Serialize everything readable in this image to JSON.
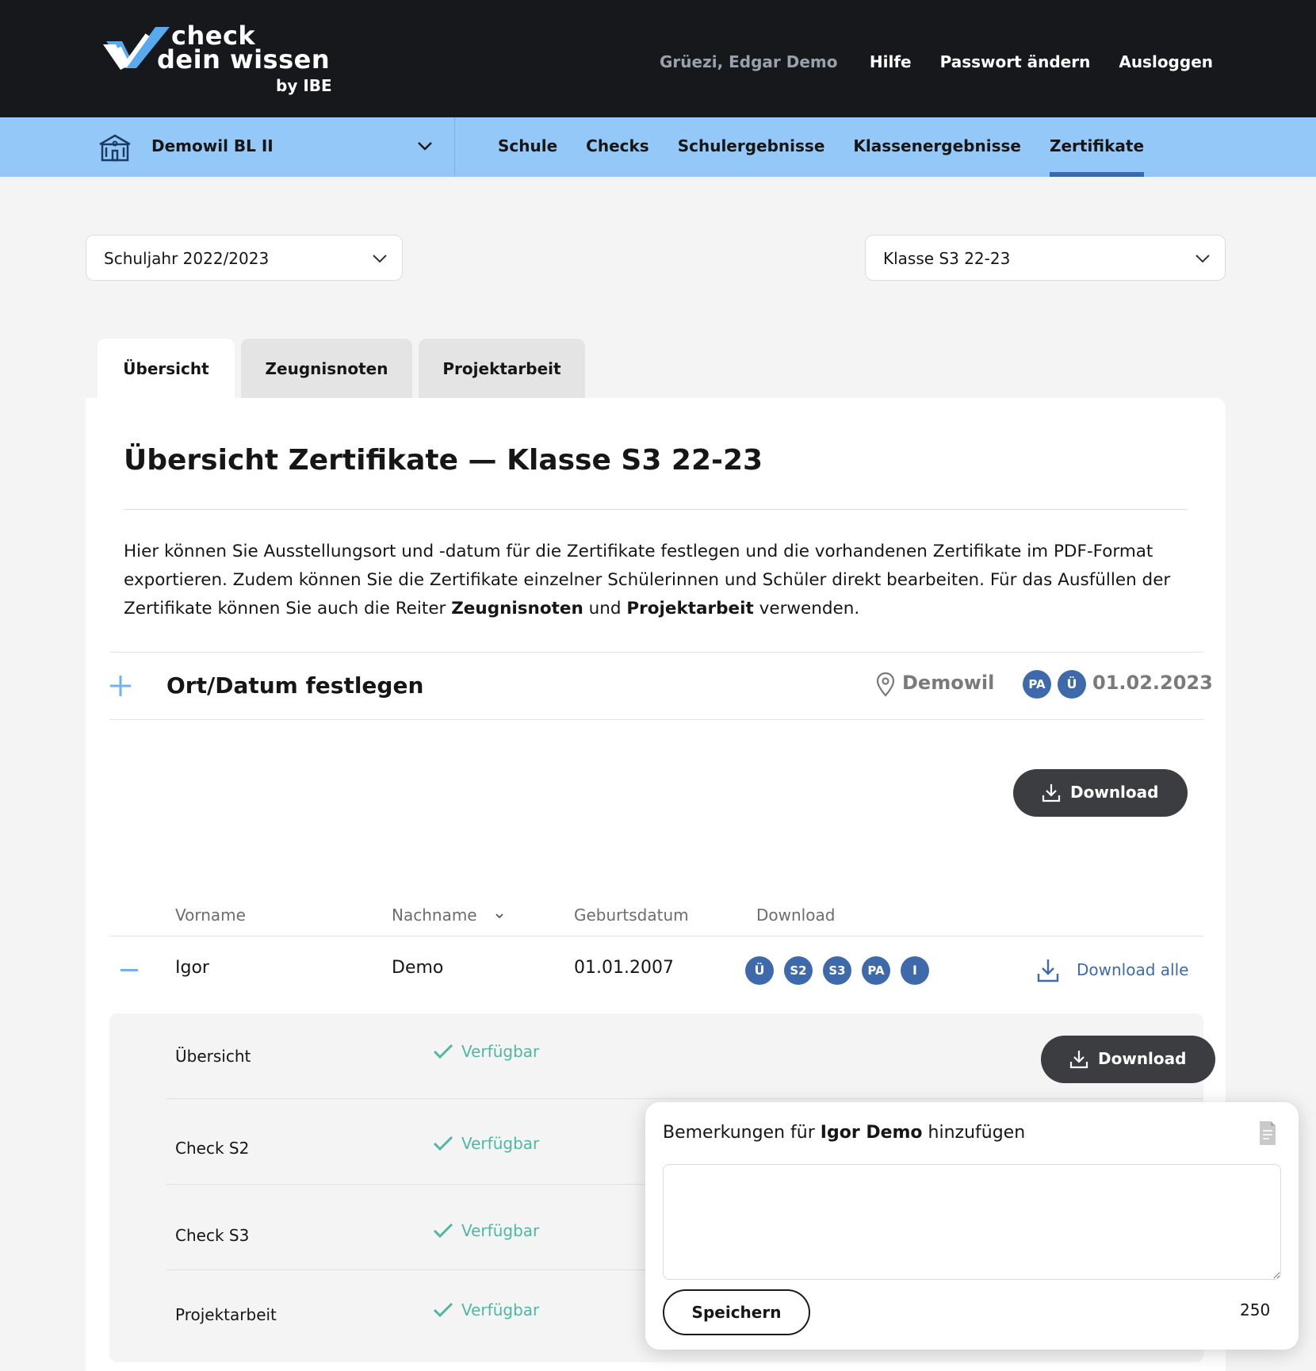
{
  "header": {
    "logo": {
      "line1": "check",
      "line2": "dein wissen",
      "line3": "by IBE"
    },
    "greeting": "Grüezi, Edgar Demo",
    "links": [
      "Hilfe",
      "Passwort ändern",
      "Ausloggen"
    ]
  },
  "subnav": {
    "school": "Demowil BL II",
    "links": [
      "Schule",
      "Checks",
      "Schulergebnisse",
      "Klassenergebnisse",
      "Zertifikate"
    ],
    "active": "Zertifikate"
  },
  "filters": {
    "year": "Schuljahr 2022/2023",
    "class": "Klasse S3 22-23"
  },
  "tabs": [
    "Übersicht",
    "Zeugnisnoten",
    "Projektarbeit"
  ],
  "card": {
    "title": "Übersicht Zertifikate — Klasse S3 22-23",
    "intro_p1": "Hier können Sie Ausstellungsort und -datum für die Zertifikate festlegen und die vorhandenen Zertifikate im PDF-Format exportieren. Zudem können Sie die Zertifikate einzelner Schülerinnen und Schüler direkt bearbeiten. Für das Ausfüllen der Zertifikate können Sie auch die Reiter ",
    "intro_b1": "Zeugnisnoten",
    "intro_mid": " und ",
    "intro_b2": "Projektarbeit",
    "intro_end": " verwenden."
  },
  "ort": {
    "title": "Ort/Datum festlegen",
    "place": "Demowil",
    "badges": [
      "PA",
      "Ü"
    ],
    "date": "01.02.2023"
  },
  "download_label": "Download",
  "table": {
    "headers": {
      "vorname": "Vorname",
      "nachname": "Nachname",
      "geburtsdatum": "Geburtsdatum",
      "download": "Download"
    },
    "row": {
      "vorname": "Igor",
      "nachname": "Demo",
      "geburtsdatum": "01.01.2007",
      "badges": [
        "Ü",
        "S2",
        "S3",
        "PA",
        "I"
      ],
      "download_all": "Download alle"
    },
    "sub_rows": [
      {
        "label": "Übersicht",
        "status": "Verfügbar"
      },
      {
        "label": "Check S2",
        "status": "Verfügbar"
      },
      {
        "label": "Check S3",
        "status": "Verfügbar"
      },
      {
        "label": "Projektarbeit",
        "status": "Verfügbar"
      }
    ]
  },
  "popup": {
    "title_pre": "Bemerkungen für ",
    "title_name": "Igor Demo",
    "title_post": " hinzufügen",
    "textarea_value": "",
    "save": "Speichern",
    "counter": "250"
  },
  "colors": {
    "header_bg": "#17181b",
    "nav_bg": "#94c8f8",
    "accent": "#3e6aab",
    "available": "#4fb7a2",
    "button_dark": "#3b3d40"
  }
}
